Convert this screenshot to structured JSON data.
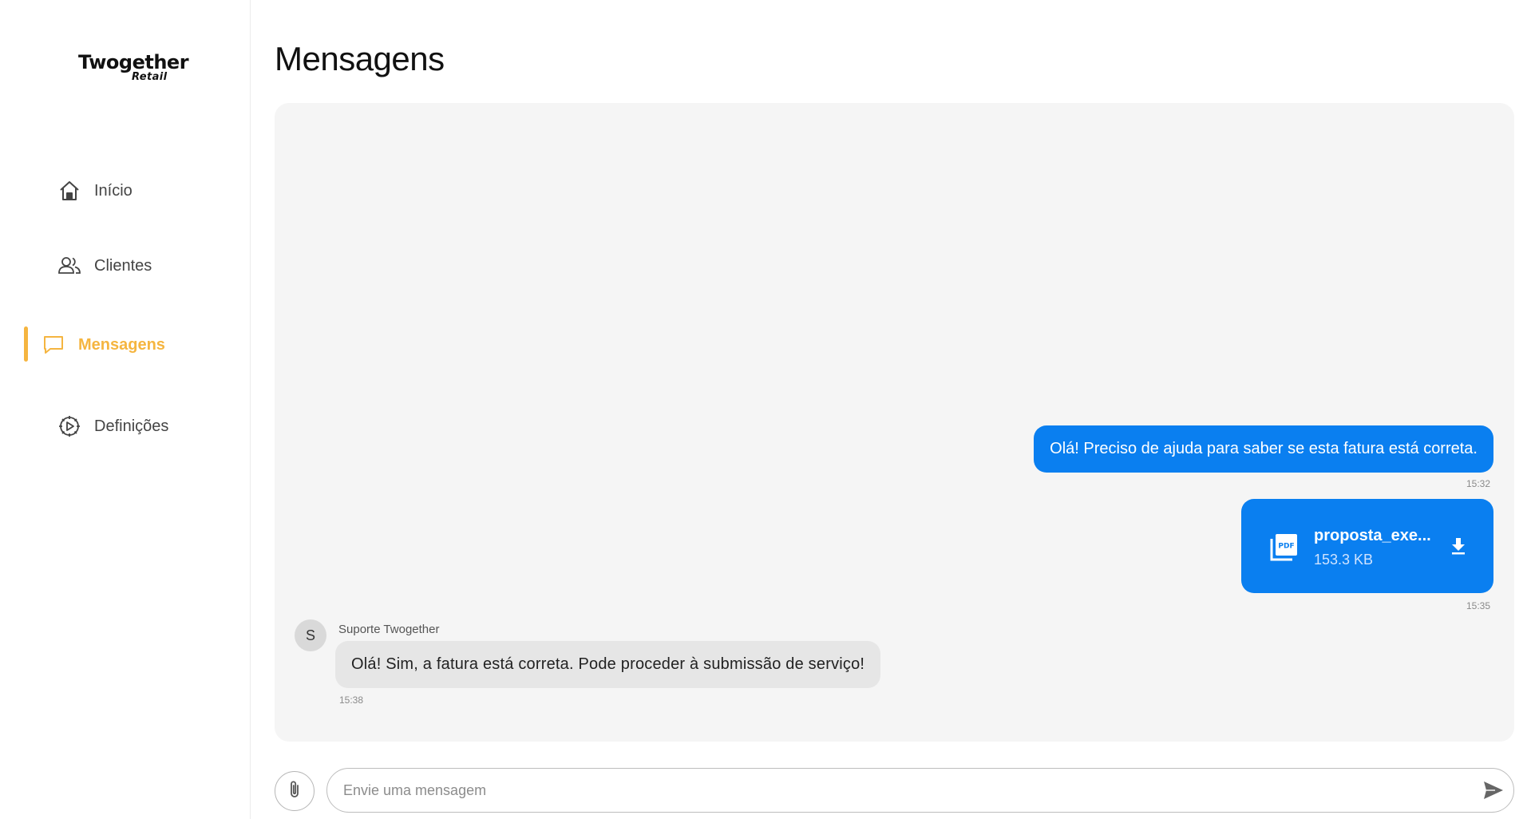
{
  "brand": {
    "name": "Twogether",
    "sub": "Retail"
  },
  "sidebar": {
    "items": [
      {
        "label": "Início",
        "icon": "home-icon",
        "active": false
      },
      {
        "label": "Clientes",
        "icon": "users-icon",
        "active": false
      },
      {
        "label": "Mensagens",
        "icon": "chat-icon",
        "active": true
      },
      {
        "label": "Definições",
        "icon": "gear-icon",
        "active": false
      }
    ],
    "accent": "#f5b540"
  },
  "page": {
    "title": "Mensagens"
  },
  "chat": {
    "outgoing_color": "#0a7ff0",
    "messages": [
      {
        "type": "text",
        "direction": "out",
        "text": "Olá! Preciso de ajuda para saber se esta fatura está correta.",
        "time": "15:32"
      },
      {
        "type": "file",
        "direction": "out",
        "file_name": "proposta_exe...",
        "file_size": "153.3 KB",
        "time": "15:35"
      },
      {
        "type": "text",
        "direction": "in",
        "sender": "Suporte Twogether",
        "avatar_initial": "S",
        "text": "Olá! Sim, a fatura está correta. Pode proceder à submissão de serviço!",
        "time": "15:38"
      }
    ]
  },
  "composer": {
    "placeholder": "Envie uma mensagem",
    "value": ""
  }
}
